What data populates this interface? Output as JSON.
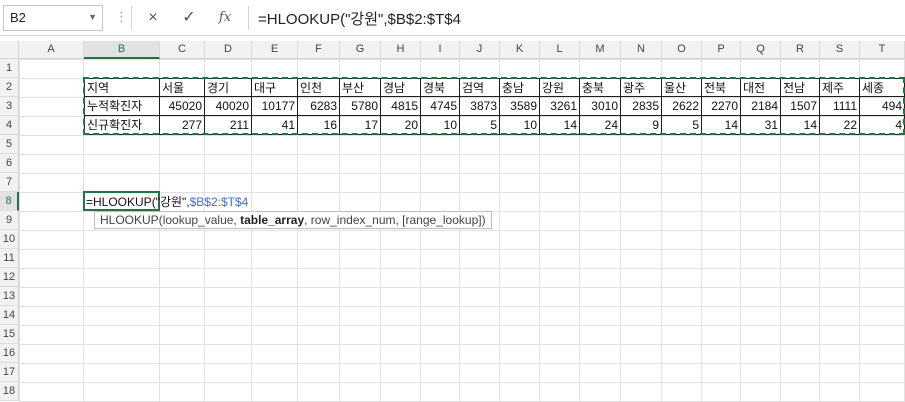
{
  "namebox": {
    "ref": "B2"
  },
  "formula_bar": {
    "dots": "⋮",
    "cancel_icon": "×",
    "enter_icon": "✓",
    "fx_label": "fx",
    "formula": "=HLOOKUP(\"강원\",$B$2:$T$4"
  },
  "columns": [
    "A",
    "B",
    "C",
    "D",
    "E",
    "F",
    "G",
    "H",
    "I",
    "J",
    "K",
    "L",
    "M",
    "N",
    "O",
    "P",
    "Q",
    "R",
    "S",
    "T"
  ],
  "rows": [
    "1",
    "2",
    "3",
    "4",
    "5",
    "6",
    "7",
    "8",
    "9",
    "10",
    "11",
    "12",
    "13",
    "14",
    "15",
    "16",
    "17",
    "18"
  ],
  "table": {
    "row2": [
      "지역",
      "서울",
      "경기",
      "대구",
      "인천",
      "부산",
      "경남",
      "경북",
      "검역",
      "충남",
      "강원",
      "충북",
      "광주",
      "울산",
      "전북",
      "대전",
      "전남",
      "제주",
      "세종"
    ],
    "row3": [
      "누적확진자",
      "45020",
      "40020",
      "10177",
      "6283",
      "5780",
      "4815",
      "4745",
      "3873",
      "3589",
      "3261",
      "3010",
      "2835",
      "2622",
      "2270",
      "2184",
      "1507",
      "1111",
      "494"
    ],
    "row4": [
      "신규확진자",
      "277",
      "211",
      "41",
      "16",
      "17",
      "20",
      "10",
      "5",
      "10",
      "14",
      "24",
      "9",
      "5",
      "14",
      "31",
      "14",
      "22",
      "4"
    ]
  },
  "active_cell": {
    "prefix": "=HLOOKUP(\"강원\",",
    "ref": "$B$2:$T$4"
  },
  "tooltip": {
    "fn": "HLOOKUP(",
    "arg1": "lookup_value, ",
    "arg2": "table_array",
    "rest": ", row_index_num, [range_lookup])"
  }
}
